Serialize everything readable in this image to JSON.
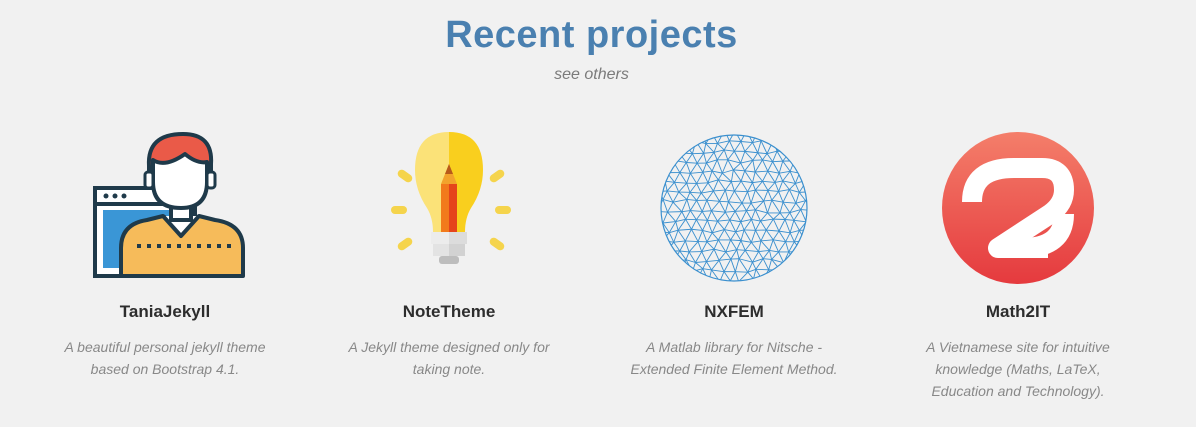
{
  "header": {
    "title": "Recent projects",
    "see_others": "see others"
  },
  "projects": [
    {
      "name": "TaniaJekyll",
      "description": "A beautiful personal jekyll theme based on Bootstrap 4.1.",
      "icon": "person-with-browser-icon"
    },
    {
      "name": "NoteTheme",
      "description": "A Jekyll theme designed only for taking note.",
      "icon": "lightbulb-pencil-icon"
    },
    {
      "name": "NXFEM",
      "description": "A Matlab library for Nitsche - Extended Finite Element Method.",
      "icon": "triangular-mesh-circle-icon"
    },
    {
      "name": "Math2IT",
      "description": "A Vietnamese site for intuitive knowledge (Maths, LaTeX, Education and Technology).",
      "icon": "math2it-logo-icon"
    }
  ],
  "colors": {
    "title": "#4a80b0",
    "background": "#f1f1f1",
    "mesh": "#3a8fce",
    "logo_red": "#ea4a46"
  }
}
